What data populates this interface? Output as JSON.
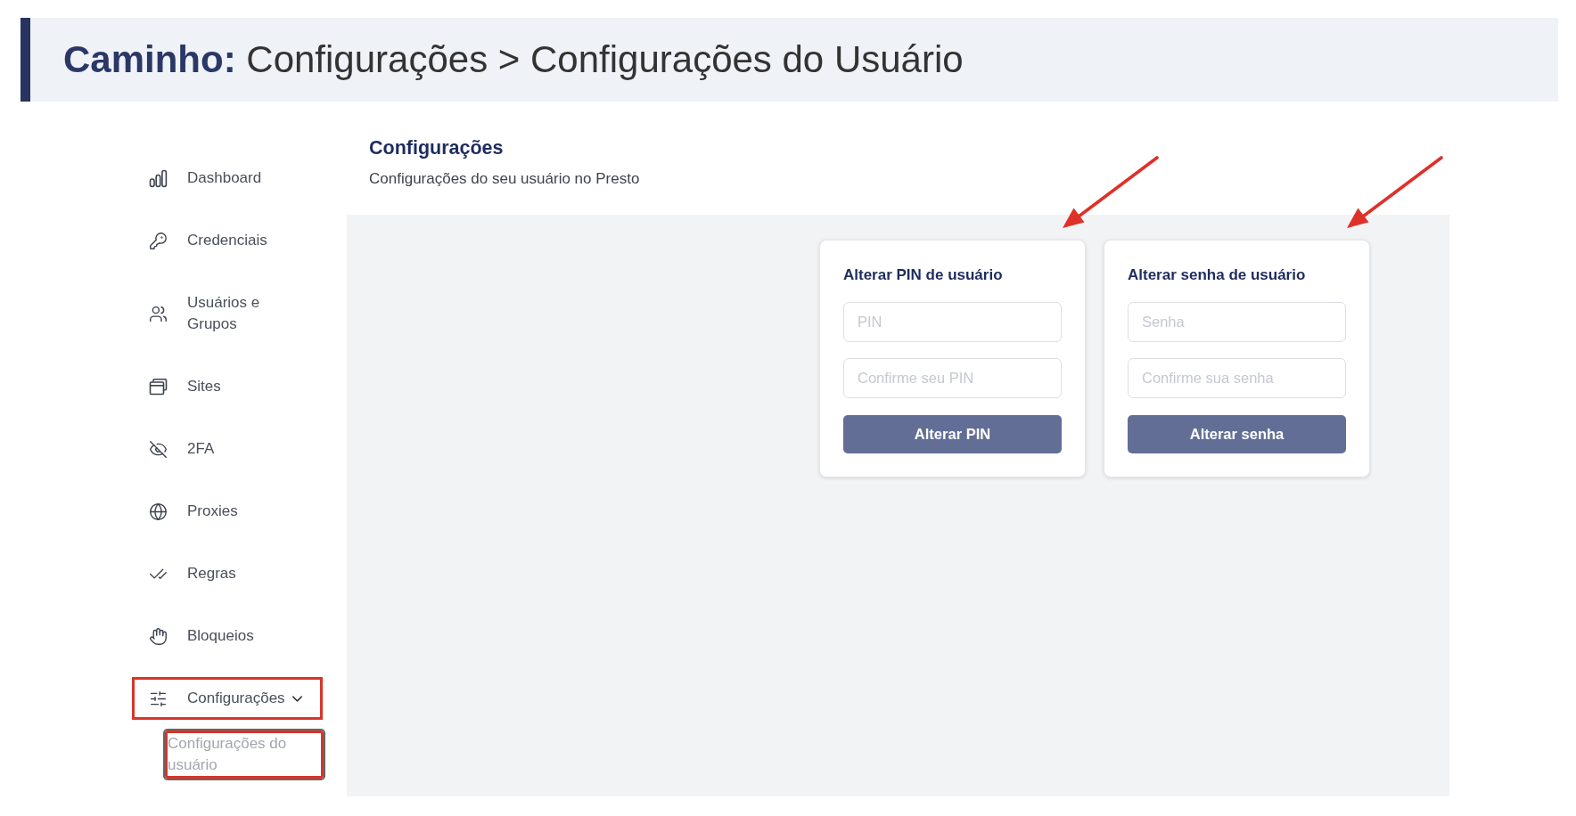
{
  "breadcrumb": "**Caminho:** Configurações > Configurações do Usuário",
  "sidebar": {
    "items": [
      {
        "label": "Dashboard",
        "highlighted": false
      },
      {
        "label": "Credenciais",
        "highlighted": false
      },
      {
        "label": "Usuários e Grupos",
        "highlighted": false
      },
      {
        "label": "Sites",
        "highlighted": false
      },
      {
        "label": "2FA",
        "highlighted": false
      },
      {
        "label": "Proxies",
        "highlighted": false
      },
      {
        "label": "Regras",
        "highlighted": false
      },
      {
        "label": "Bloqueios",
        "highlighted": false
      },
      {
        "label": "Configurações",
        "highlighted": true,
        "expanded": true,
        "children": [
          {
            "label": "Configurações do usuário",
            "highlighted": true
          }
        ]
      }
    ]
  },
  "header": {
    "title": "Configurações",
    "subtitle": "Configurações do seu usuário no Presto"
  },
  "cards": [
    {
      "title": "Alterar PIN de usuário",
      "fields": [
        {
          "placeholder": "PIN"
        },
        {
          "placeholder": "Confirme seu PIN"
        }
      ],
      "button": "Alterar PIN",
      "arrow": true
    },
    {
      "title": "Alterar senha de usuário",
      "fields": [
        {
          "placeholder": "Senha"
        },
        {
          "placeholder": "Confirme sua senha"
        }
      ],
      "button": "Alterar senha",
      "arrow": true
    }
  ]
}
